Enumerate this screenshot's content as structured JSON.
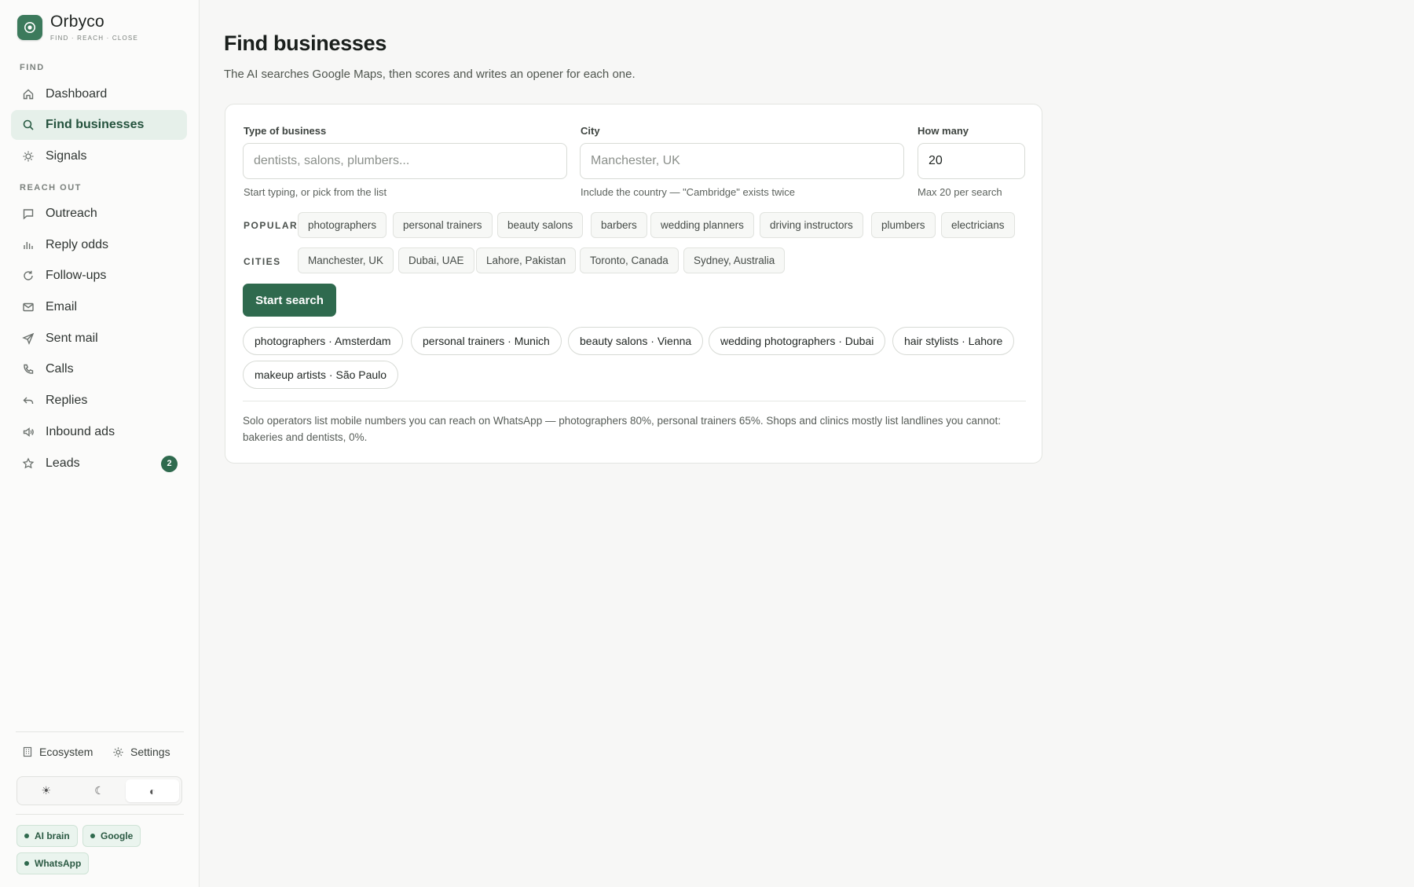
{
  "brand": {
    "name": "Orbyco",
    "tagline": "FIND · REACH · CLOSE"
  },
  "sidebar": {
    "sections": [
      {
        "label": "FIND",
        "items": [
          {
            "label": "Dashboard",
            "icon": "home-icon"
          },
          {
            "label": "Find businesses",
            "icon": "search-icon",
            "active": true
          },
          {
            "label": "Signals",
            "icon": "sun-icon"
          }
        ]
      },
      {
        "label": "REACH OUT",
        "items": [
          {
            "label": "Outreach",
            "icon": "chat-icon"
          },
          {
            "label": "Reply odds",
            "icon": "bar-chart-icon"
          },
          {
            "label": "Follow-ups",
            "icon": "refresh-icon"
          },
          {
            "label": "Email",
            "icon": "mail-icon"
          },
          {
            "label": "Sent mail",
            "icon": "send-icon"
          },
          {
            "label": "Calls",
            "icon": "phone-icon"
          },
          {
            "label": "Replies",
            "icon": "reply-icon"
          },
          {
            "label": "Inbound ads",
            "icon": "megaphone-icon"
          },
          {
            "label": "Leads",
            "icon": "star-icon",
            "badge": "2"
          }
        ]
      }
    ],
    "footer_links": {
      "ecosystem": "Ecosystem",
      "settings": "Settings"
    },
    "theme_options": {
      "light": "☀",
      "dark": "☾",
      "system": "◐",
      "selected": "system"
    },
    "status_pills": [
      "AI brain",
      "Google",
      "WhatsApp"
    ]
  },
  "main": {
    "title": "Find businesses",
    "subtitle": "The AI searches Google Maps, then scores and writes an opener for each one.",
    "form": {
      "type": {
        "label": "Type of business",
        "placeholder": "dentists, salons, plumbers...",
        "value": "",
        "hint": "Start typing, or pick from the list"
      },
      "city": {
        "label": "City",
        "placeholder": "Manchester, UK",
        "value": "",
        "hint": "Include the country — \"Cambridge\" exists twice"
      },
      "count": {
        "label": "How many",
        "value": "20",
        "hint": "Max 20 per search"
      }
    },
    "popular_label": "POPULAR",
    "popular": [
      "photographers",
      "personal trainers",
      "beauty salons",
      "barbers",
      "wedding planners",
      "driving instructors",
      "plumbers",
      "electricians"
    ],
    "cities_label": "CITIES",
    "cities": [
      "Manchester, UK",
      "Dubai, UAE",
      "Lahore, Pakistan",
      "Toronto, Canada",
      "Sydney, Australia"
    ],
    "start_button": "Start search",
    "recent_searches": [
      "photographers · Amsterdam",
      "personal trainers · Munich",
      "beauty salons · Vienna",
      "wedding photographers · Dubai",
      "hair stylists · Lahore",
      "makeup artists · São Paulo"
    ],
    "note": "Solo operators list mobile numbers you can reach on WhatsApp — photographers 80%, personal trainers 65%. Shops and clinics mostly list landlines you cannot: bakeries and dentists, 0%."
  },
  "colors": {
    "accent": "#2f6a4e",
    "accent_light": "#e6f0ea",
    "background": "#f7f7f6"
  }
}
